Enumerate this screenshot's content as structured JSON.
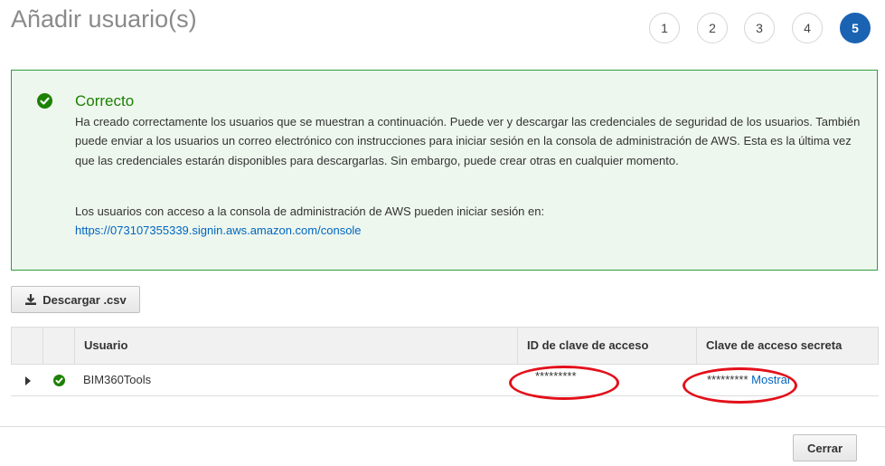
{
  "page": {
    "title": "Añadir usuario(s)"
  },
  "steps": {
    "items": [
      "1",
      "2",
      "3",
      "4",
      "5"
    ],
    "active": "5"
  },
  "success": {
    "title": "Correcto",
    "message": "Ha creado correctamente los usuarios que se muestran a continuación. Puede ver y descargar las credenciales de seguridad de los usuarios. También puede enviar a los usuarios un correo electrónico con instrucciones para iniciar sesión en la consola de administración de AWS. Esta es la última vez que las credenciales estarán disponibles para descargarlas. Sin embargo, puede crear otras en cualquier momento.",
    "login_text": "Los usuarios con acceso a la consola de administración de AWS pueden iniciar sesión en:",
    "login_url": "https://073107355339.signin.aws.amazon.com/console"
  },
  "toolbar": {
    "download_label": "Descargar .csv"
  },
  "table": {
    "columns": [
      "Usuario",
      "ID de clave de acceso",
      "Clave de acceso secreta"
    ],
    "rows": [
      {
        "user": "BIM360Tools",
        "access_key_id": "*********",
        "secret_key": "*********",
        "show_label": "Mostrar"
      }
    ]
  },
  "footer": {
    "close_label": "Cerrar"
  },
  "colors": {
    "primary": "#1a63b3",
    "success": "#1d8102",
    "link": "#0066c0",
    "annotation": "#e3101a"
  }
}
